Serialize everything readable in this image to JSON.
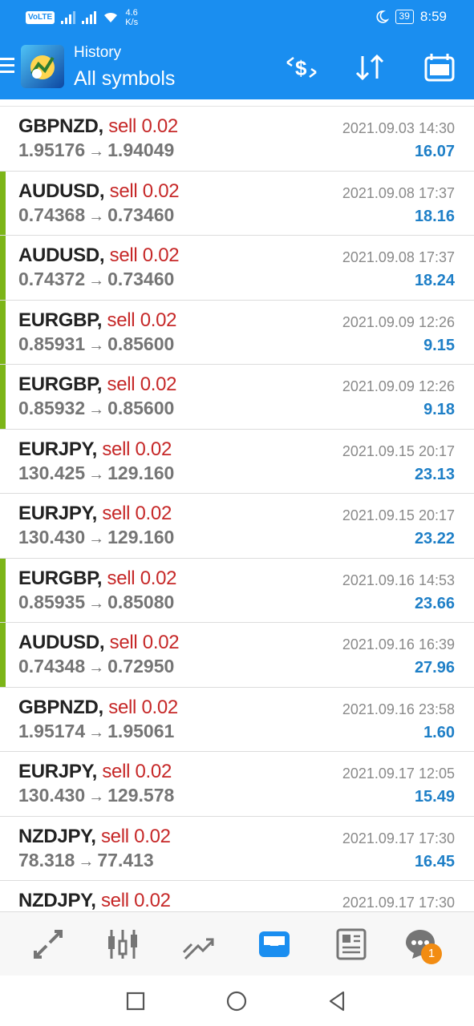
{
  "status_bar": {
    "volte": "VoLTE",
    "network_speed_value": "4.6",
    "network_speed_unit": "K/s",
    "battery": "39",
    "time": "8:59"
  },
  "toolbar": {
    "subtitle": "History",
    "title": "All symbols",
    "icons": [
      "menu-icon",
      "app-logo",
      "currency-exchange-icon",
      "sort-icon",
      "calendar-icon"
    ],
    "accent_color": "#1a8ef0"
  },
  "trades": [
    {
      "symbol": "GBPNZD,",
      "side": "sell 0.02",
      "open": "1.95176",
      "close": "1.94049",
      "time": "2021.09.03 14:30",
      "profit": "16.07",
      "marked": false
    },
    {
      "symbol": "AUDUSD,",
      "side": "sell 0.02",
      "open": "0.74368",
      "close": "0.73460",
      "time": "2021.09.08 17:37",
      "profit": "18.16",
      "marked": true
    },
    {
      "symbol": "AUDUSD,",
      "side": "sell 0.02",
      "open": "0.74372",
      "close": "0.73460",
      "time": "2021.09.08 17:37",
      "profit": "18.24",
      "marked": true
    },
    {
      "symbol": "EURGBP,",
      "side": "sell 0.02",
      "open": "0.85931",
      "close": "0.85600",
      "time": "2021.09.09 12:26",
      "profit": "9.15",
      "marked": true
    },
    {
      "symbol": "EURGBP,",
      "side": "sell 0.02",
      "open": "0.85932",
      "close": "0.85600",
      "time": "2021.09.09 12:26",
      "profit": "9.18",
      "marked": true
    },
    {
      "symbol": "EURJPY,",
      "side": "sell 0.02",
      "open": "130.425",
      "close": "129.160",
      "time": "2021.09.15 20:17",
      "profit": "23.13",
      "marked": false
    },
    {
      "symbol": "EURJPY,",
      "side": "sell 0.02",
      "open": "130.430",
      "close": "129.160",
      "time": "2021.09.15 20:17",
      "profit": "23.22",
      "marked": false
    },
    {
      "symbol": "EURGBP,",
      "side": "sell 0.02",
      "open": "0.85935",
      "close": "0.85080",
      "time": "2021.09.16 14:53",
      "profit": "23.66",
      "marked": true
    },
    {
      "symbol": "AUDUSD,",
      "side": "sell 0.02",
      "open": "0.74348",
      "close": "0.72950",
      "time": "2021.09.16 16:39",
      "profit": "27.96",
      "marked": true
    },
    {
      "symbol": "GBPNZD,",
      "side": "sell 0.02",
      "open": "1.95174",
      "close": "1.95061",
      "time": "2021.09.16 23:58",
      "profit": "1.60",
      "marked": false
    },
    {
      "symbol": "EURJPY,",
      "side": "sell 0.02",
      "open": "130.430",
      "close": "129.578",
      "time": "2021.09.17 12:05",
      "profit": "15.49",
      "marked": false
    },
    {
      "symbol": "NZDJPY,",
      "side": "sell 0.02",
      "open": "78.318",
      "close": "77.413",
      "time": "2021.09.17 17:30",
      "profit": "16.45",
      "marked": false
    },
    {
      "symbol": "NZDJPY,",
      "side": "sell 0.02",
      "open": "",
      "close": "",
      "time": "2021.09.17 17:30",
      "profit": "",
      "marked": false
    }
  ],
  "arrow_glyph": "→",
  "tab_bar": {
    "tabs": [
      "quotes-icon",
      "chart-icon",
      "trade-icon",
      "history-icon",
      "news-icon",
      "chat-icon"
    ],
    "active_tab": "history-icon",
    "chat_badge": "1"
  },
  "system_nav": [
    "recents-button",
    "home-button",
    "back-button"
  ]
}
